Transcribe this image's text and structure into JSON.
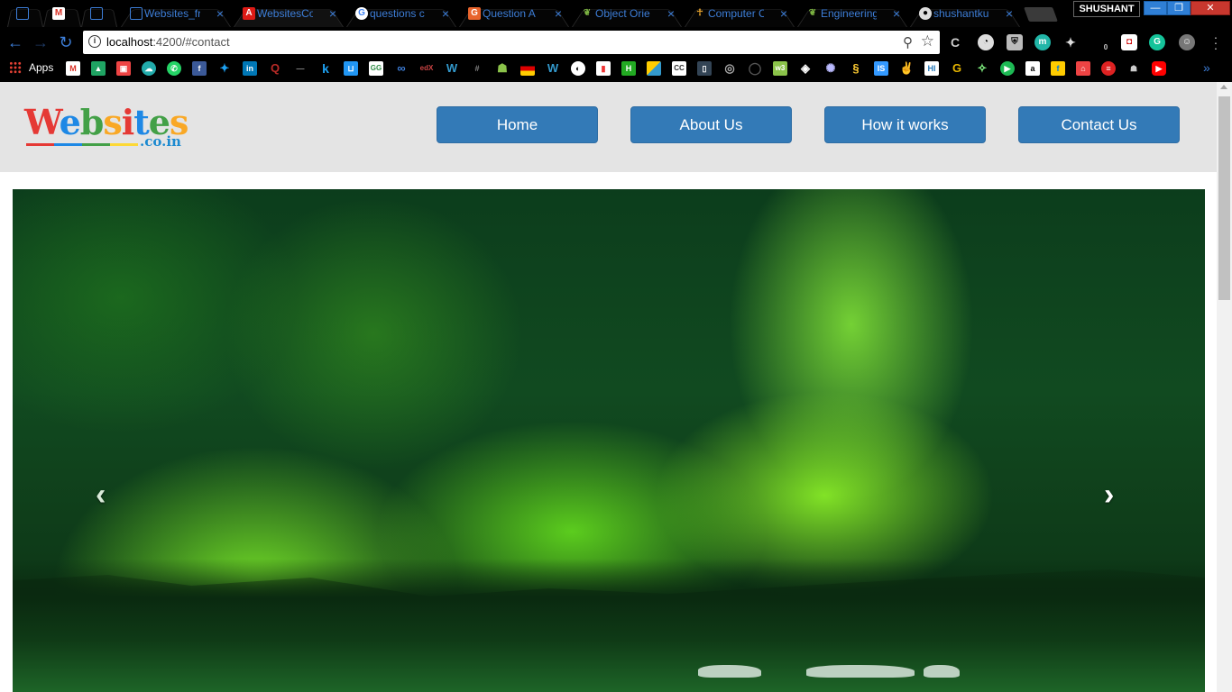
{
  "browser": {
    "tabs": [
      {
        "label": "",
        "icon": "page-icon"
      },
      {
        "label": "",
        "icon": "gmail-icon"
      },
      {
        "label": "",
        "icon": "page-icon"
      },
      {
        "label": "Websites_fr",
        "icon": "page-icon"
      },
      {
        "label": "WebsitesCo",
        "icon": "angular-icon",
        "active": true
      },
      {
        "label": "questions c",
        "icon": "google-icon"
      },
      {
        "label": "Question A",
        "icon": "gk-icon"
      },
      {
        "label": "Object Orie",
        "icon": "leaf-icon"
      },
      {
        "label": "Computer C",
        "icon": "figure-icon"
      },
      {
        "label": "Engineering",
        "icon": "leaf-icon"
      },
      {
        "label": "shushantku",
        "icon": "github-icon"
      }
    ],
    "tab_close": "×",
    "profile_name": "SHUSHANT",
    "window_minimize": "—",
    "window_maximize": "❐",
    "window_close": "✕",
    "url_host": "localhost",
    "url_rest": ":4200/#contact",
    "info_glyph": "i",
    "back_glyph": "←",
    "forward_glyph": "→",
    "reload_glyph": "↻",
    "zoom_glyph": "⚲",
    "star_glyph": "☆",
    "bookmarks_apps_label": "Apps",
    "extension_badge": "0",
    "bookmarks_more": "»"
  },
  "site": {
    "logo_word": "Websites",
    "logo_tld": ".co.in",
    "nav": {
      "home": "Home",
      "about": "About Us",
      "how": "How it works",
      "contact": "Contact Us"
    },
    "carousel_prev": "‹",
    "carousel_next": "›"
  },
  "colors": {
    "nav_button": "#337ab7",
    "header_bg": "#e4e4e4",
    "tab_text": "#3d7ed8"
  }
}
